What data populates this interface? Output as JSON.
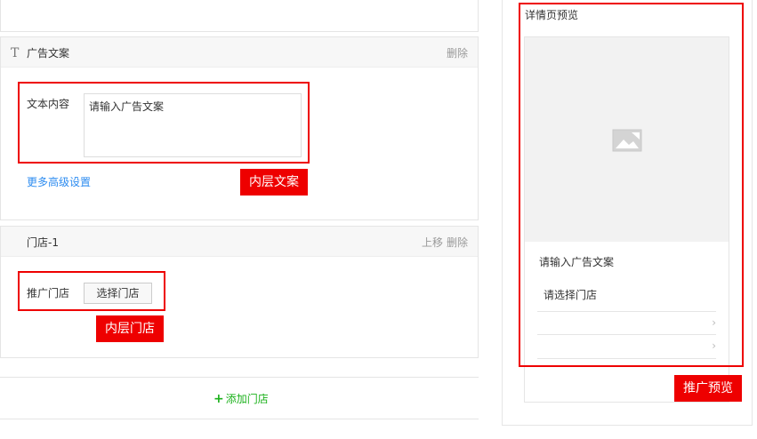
{
  "ad_section": {
    "icon": "text-icon",
    "icon_glyph": "T",
    "title": "广告文案",
    "delete_label": "删除",
    "content_label": "文本内容",
    "textarea_placeholder": "请输入广告文案",
    "more_settings_link": "更多高级设置"
  },
  "store_section": {
    "title": "门店-1",
    "move_up_label": "上移",
    "delete_label": "删除",
    "promote_label": "推广门店",
    "select_button": "选择门店"
  },
  "add_store": {
    "icon": "plus-icon",
    "icon_glyph": "+",
    "label": "添加门店"
  },
  "annotations": {
    "inner_text": "内层文案",
    "inner_store": "内层门店",
    "preview": "推广预览"
  },
  "preview": {
    "title": "详情页预览",
    "image_icon": "image-placeholder-icon",
    "ad_text": "请输入广告文案",
    "store_text": "请选择门店",
    "chevron_glyph": "›"
  },
  "colors": {
    "annotation_red": "#ee0000",
    "link_blue": "#2d8cf0",
    "add_green": "#1bb11b",
    "header_bg": "#f7f7f7",
    "image_placeholder_bg": "#f2f2f2"
  }
}
